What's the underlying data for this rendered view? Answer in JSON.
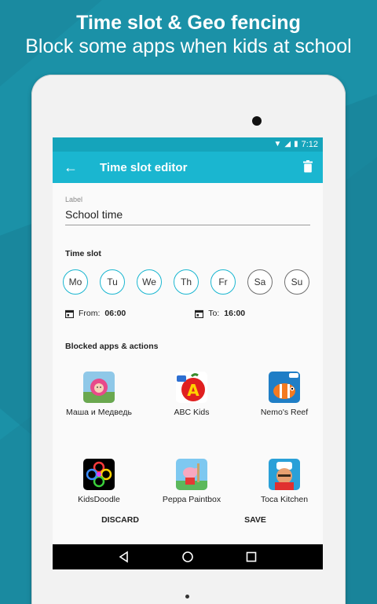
{
  "promo": {
    "title": "Time slot & Geo fencing",
    "subtitle": "Block some apps when kids at school"
  },
  "status_bar": {
    "time": "7:12"
  },
  "app_bar": {
    "title": "Time slot editor"
  },
  "label_field": {
    "caption": "Label",
    "value": "School time"
  },
  "time_slot": {
    "title": "Time slot",
    "days": [
      {
        "label": "Mo",
        "selected": true
      },
      {
        "label": "Tu",
        "selected": true
      },
      {
        "label": "We",
        "selected": true
      },
      {
        "label": "Th",
        "selected": true
      },
      {
        "label": "Fr",
        "selected": true
      },
      {
        "label": "Sa",
        "selected": false
      },
      {
        "label": "Su",
        "selected": false
      }
    ],
    "from_label": "From:",
    "from_value": "06:00",
    "to_label": "To:",
    "to_value": "16:00"
  },
  "blocked": {
    "title": "Blocked apps & actions",
    "apps": [
      {
        "name": "Маша и Медведь",
        "icon": "masha-icon"
      },
      {
        "name": "ABC Kids",
        "icon": "abc-kids-icon"
      },
      {
        "name": "Nemo's Reef",
        "icon": "nemo-icon"
      },
      {
        "name": "KidsDoodle",
        "icon": "kidsdoodle-icon"
      },
      {
        "name": "Peppa Paintbox",
        "icon": "peppa-icon"
      },
      {
        "name": "Toca Kitchen",
        "icon": "toca-kitchen-icon"
      }
    ]
  },
  "actions": {
    "discard": "DISCARD",
    "save": "SAVE"
  },
  "colors": {
    "accent": "#1ab6d0",
    "status_bar": "#15a4bb",
    "background": "#1a8aa0"
  }
}
